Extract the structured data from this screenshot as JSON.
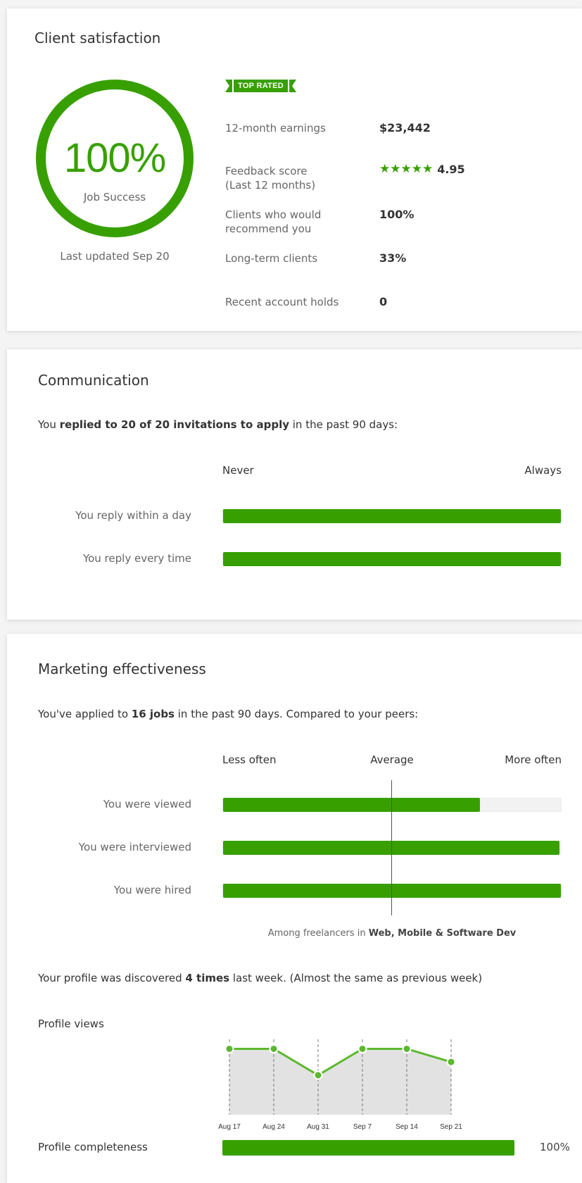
{
  "colors": {
    "accent": "#37a000",
    "track": "#f2f2f2",
    "muted_text": "#666666",
    "area_fill": "#e2e2e2",
    "line": "#5cb82e"
  },
  "client_satisfaction": {
    "title": "Client satisfaction",
    "job_success": {
      "percent_text": "100%",
      "percent_value": 100,
      "label": "Job Success",
      "last_updated": "Last updated Sep 20"
    },
    "badge": "TOP RATED",
    "stats": [
      {
        "label_line1": "12-month earnings",
        "label_line2": "",
        "value": "$23,442"
      },
      {
        "label_line1": "Feedback score",
        "label_line2": "(Last 12 months)",
        "value": "4.95",
        "stars": "★★★★★"
      },
      {
        "label_line1": "Clients who would",
        "label_line2": "recommend you",
        "value": "100%"
      },
      {
        "label_line1": "Long-term clients",
        "label_line2": "",
        "value": "33%"
      },
      {
        "label_line1": "Recent account holds",
        "label_line2": "",
        "value": "0"
      }
    ]
  },
  "communication": {
    "title": "Communication",
    "summary_pre": "You ",
    "summary_bold": "replied to 20 of 20 invitations to apply",
    "summary_post": " in the past 90 days:",
    "scale_left": "Never",
    "scale_right": "Always",
    "rows": [
      {
        "label": "You reply within a day",
        "fraction": 1.0
      },
      {
        "label": "You reply every time",
        "fraction": 1.0
      }
    ]
  },
  "marketing": {
    "title": "Marketing effectiveness",
    "summary_pre": "You've applied to ",
    "summary_bold": "16 jobs",
    "summary_post": " in the past 90 days. Compared to your peers:",
    "scale_left": "Less often",
    "scale_mid": "Average",
    "scale_right": "More often",
    "rows": [
      {
        "label": "You were viewed",
        "fraction": 0.76
      },
      {
        "label": "You were interviewed",
        "fraction": 0.995
      },
      {
        "label": "You were hired",
        "fraction": 1.0
      }
    ],
    "footnote_pre": "Among freelancers in ",
    "footnote_bold": "Web, Mobile & Software Dev",
    "discovered_pre": "Your profile was discovered ",
    "discovered_bold": "4 times",
    "discovered_post": " last week. (Almost the same as previous week)",
    "profile_views_label": "Profile views",
    "profile_completeness_label": "Profile completeness",
    "profile_completeness_value": "100%",
    "profile_completeness_fraction": 0.86
  },
  "chart_data": {
    "type": "area",
    "categories": [
      "Aug 17",
      "Aug 24",
      "Aug 31",
      "Sep 7",
      "Sep 14",
      "Sep 21"
    ],
    "values": [
      5,
      5,
      3,
      5,
      5,
      4
    ],
    "ylim": [
      0,
      5.4
    ],
    "grid": "dashed vertical",
    "title": "",
    "xlabel": "",
    "ylabel": ""
  }
}
